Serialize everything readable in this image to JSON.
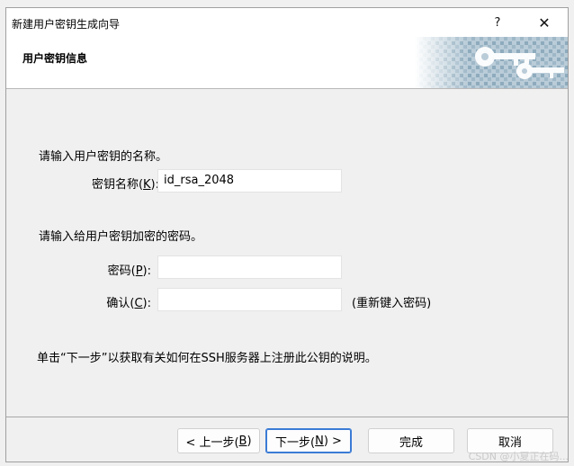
{
  "window": {
    "title": "新建用户密钥生成向导",
    "help_glyph": "?",
    "close_glyph": "✕"
  },
  "header": {
    "title": "用户密钥信息",
    "art_icon": "keys-icon"
  },
  "form": {
    "name_prompt": "请输入用户密钥的名称。",
    "key_name_label": "密钥名称(K):",
    "key_name_label_pre": "密钥名称(",
    "key_name_label_key": "K",
    "key_name_label_post": "):",
    "key_name_value": "id_rsa_2048",
    "password_prompt": "请输入给用户密钥加密的密码。",
    "password_label_pre": "密码(",
    "password_label_key": "P",
    "password_label_post": "):",
    "password_value": "",
    "confirm_label_pre": "确认(",
    "confirm_label_key": "C",
    "confirm_label_post": "):",
    "confirm_value": "",
    "confirm_hint": "(重新键入密码)",
    "info_text": "单击“下一步”以获取有关如何在SSH服务器上注册此公钥的说明。"
  },
  "buttons": {
    "back_pre": "< 上一步(",
    "back_key": "B",
    "back_post": ")",
    "next_pre": "下一步(",
    "next_key": "N",
    "next_post": ") >",
    "finish": "完成",
    "cancel": "取消"
  },
  "watermark": "CSDN @小夏正在码..."
}
